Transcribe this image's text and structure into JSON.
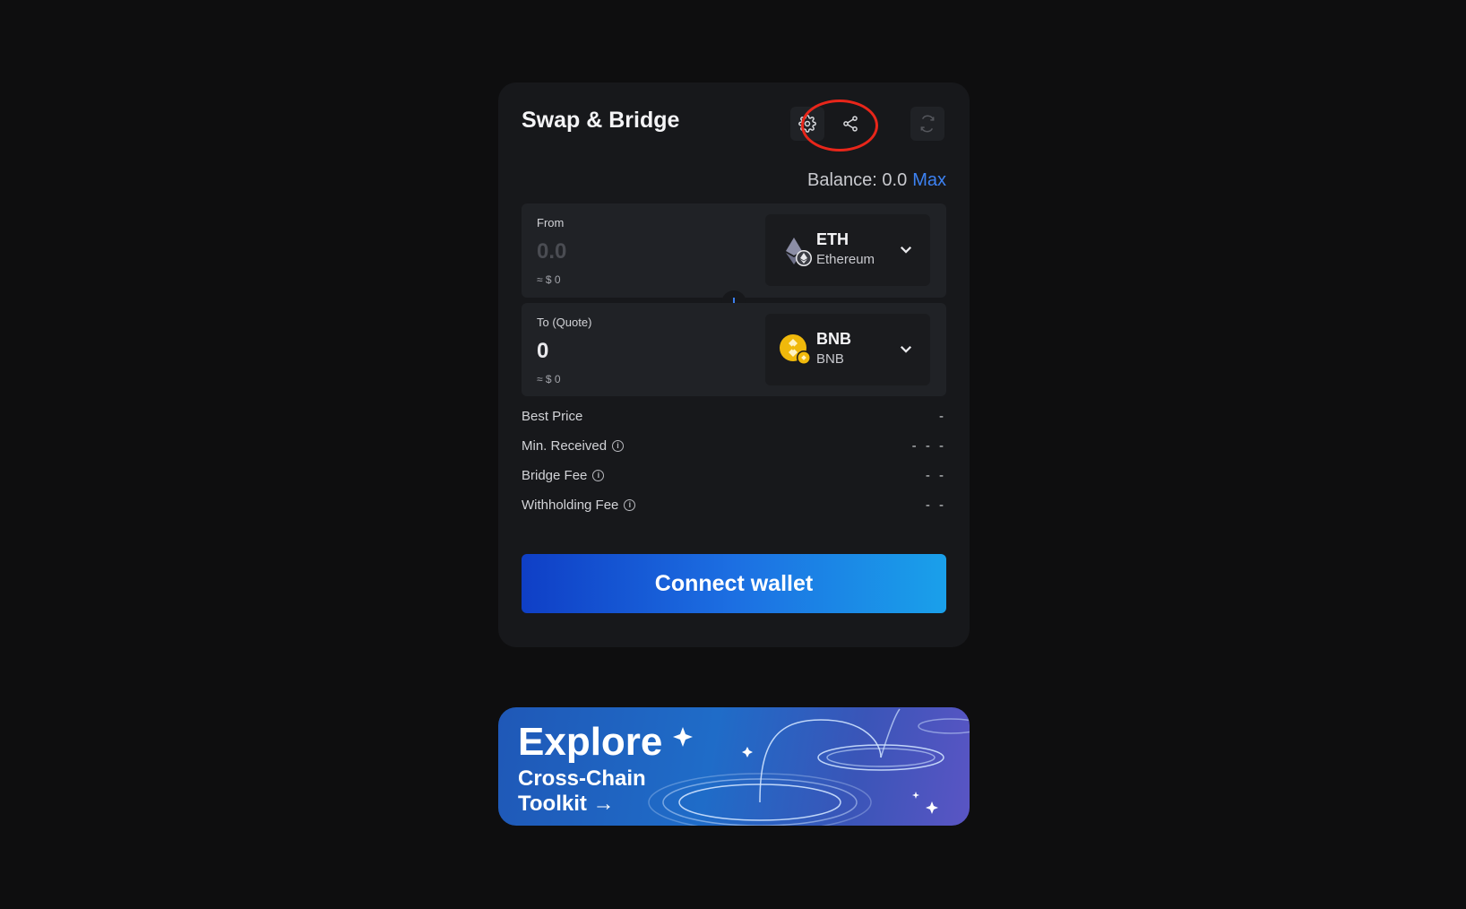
{
  "swap": {
    "title": "Swap & Bridge",
    "balance_label": "Balance: 0.0",
    "max_label": "Max",
    "from": {
      "label": "From",
      "amount_placeholder": "0.0",
      "usd": "≈ $ 0",
      "token": {
        "symbol": "ETH",
        "network": "Ethereum",
        "icon": "ethereum-icon"
      }
    },
    "to": {
      "label": "To (Quote)",
      "amount": "0",
      "usd": "≈ $ 0",
      "token": {
        "symbol": "BNB",
        "network": "BNB",
        "icon": "bnb-icon"
      }
    },
    "details": [
      {
        "label": "Best Price",
        "value": "-",
        "info": false
      },
      {
        "label": "Min. Received",
        "value": "- - -",
        "info": true
      },
      {
        "label": "Bridge Fee",
        "value": "- -",
        "info": true
      },
      {
        "label": "Withholding Fee",
        "value": "- -",
        "info": true
      }
    ],
    "connect_label": "Connect wallet"
  },
  "banner": {
    "line1": "Explore",
    "line2": "Cross-Chain",
    "line3": "Toolkit →"
  },
  "colors": {
    "accent": "#3d82f3",
    "highlight": "#e8261a"
  }
}
